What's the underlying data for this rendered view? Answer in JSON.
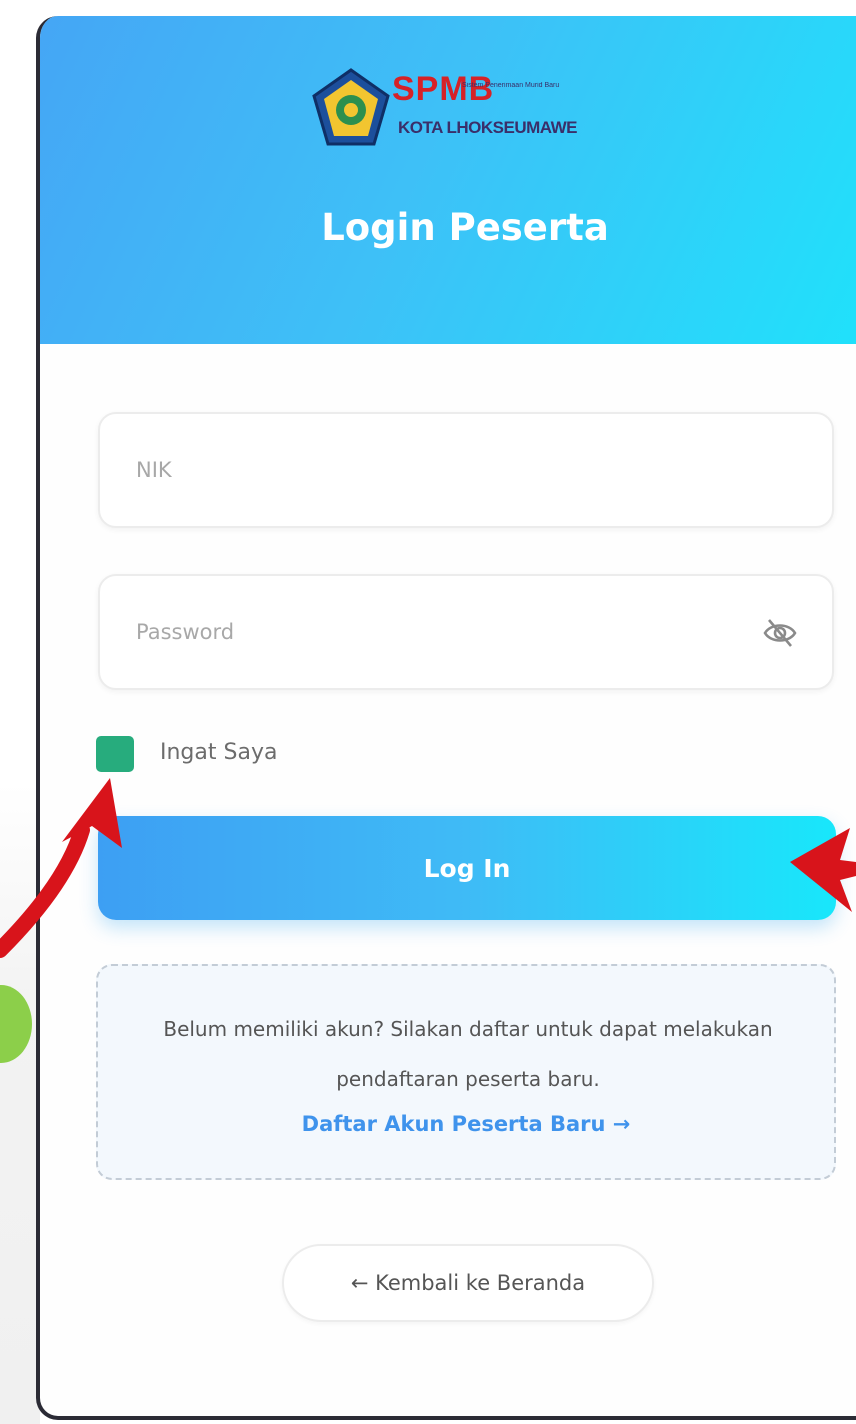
{
  "logo": {
    "spmb": "SPMB",
    "tagline": "Sistem Penerimaan Murid Baru",
    "city": "KOTA LHOKSEUMAWE"
  },
  "header": {
    "title": "Login Peserta"
  },
  "form": {
    "nik_placeholder": "NIK",
    "password_placeholder": "Password",
    "remember_label": "Ingat Saya",
    "login_label": "Log In"
  },
  "register": {
    "text": "Belum memiliki akun? Silakan daftar untuk dapat melakukan pendaftaran peserta baru.",
    "link": "Daftar Akun Peserta Baru →"
  },
  "footer": {
    "back_label": "← Kembali ke Beranda"
  },
  "colors": {
    "header_gradient_start": "#45a6f5",
    "header_gradient_end": "#1fe2fb",
    "checkbox": "#27ac7d",
    "link": "#3f93ec",
    "annotation_arrow": "#d8141b"
  },
  "icons": {
    "password_toggle": "eye-off-icon"
  }
}
